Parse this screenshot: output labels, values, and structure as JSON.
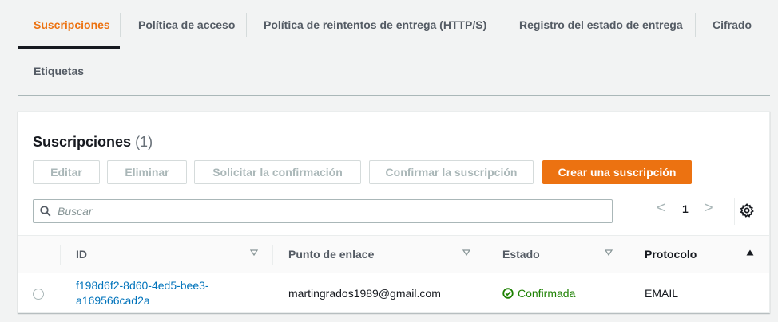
{
  "tabs": [
    {
      "label": "Suscripciones"
    },
    {
      "label": "Política de acceso"
    },
    {
      "label": "Política de reintentos de entrega (HTTP/S)"
    },
    {
      "label": "Registro del estado de entrega"
    },
    {
      "label": "Cifrado"
    },
    {
      "label": "Etiquetas"
    }
  ],
  "colors": {
    "accent": "#ec7211",
    "link": "#0073bb",
    "success": "#1d8102"
  },
  "panel": {
    "title": "Suscripciones",
    "count": "(1)",
    "buttons": {
      "edit": "Editar",
      "delete": "Eliminar",
      "request_confirmation": "Solicitar la confirmación",
      "confirm_subscription": "Confirmar la suscripción",
      "create_subscription": "Crear una suscripción"
    },
    "search": {
      "placeholder": "Buscar",
      "value": ""
    },
    "pagination": {
      "prev": "<",
      "page": "1",
      "next": ">"
    }
  },
  "table": {
    "columns": [
      {
        "label": "ID",
        "sort": "filter"
      },
      {
        "label": "Punto de enlace",
        "sort": "filter"
      },
      {
        "label": "Estado",
        "sort": "filter"
      },
      {
        "label": "Protocolo",
        "sort": "ascending"
      }
    ],
    "rows": [
      {
        "id": "f198d6f2-8d60-4ed5-bee3-a169566cad2a",
        "endpoint": "martingrados1989@gmail.com",
        "status": "Confirmada",
        "protocol": "EMAIL"
      }
    ]
  },
  "icons": [
    "search-icon",
    "chevron-left-icon",
    "chevron-right-icon",
    "gear-icon",
    "sort-filter-icon",
    "sort-ascending-icon",
    "check-circle-icon"
  ]
}
